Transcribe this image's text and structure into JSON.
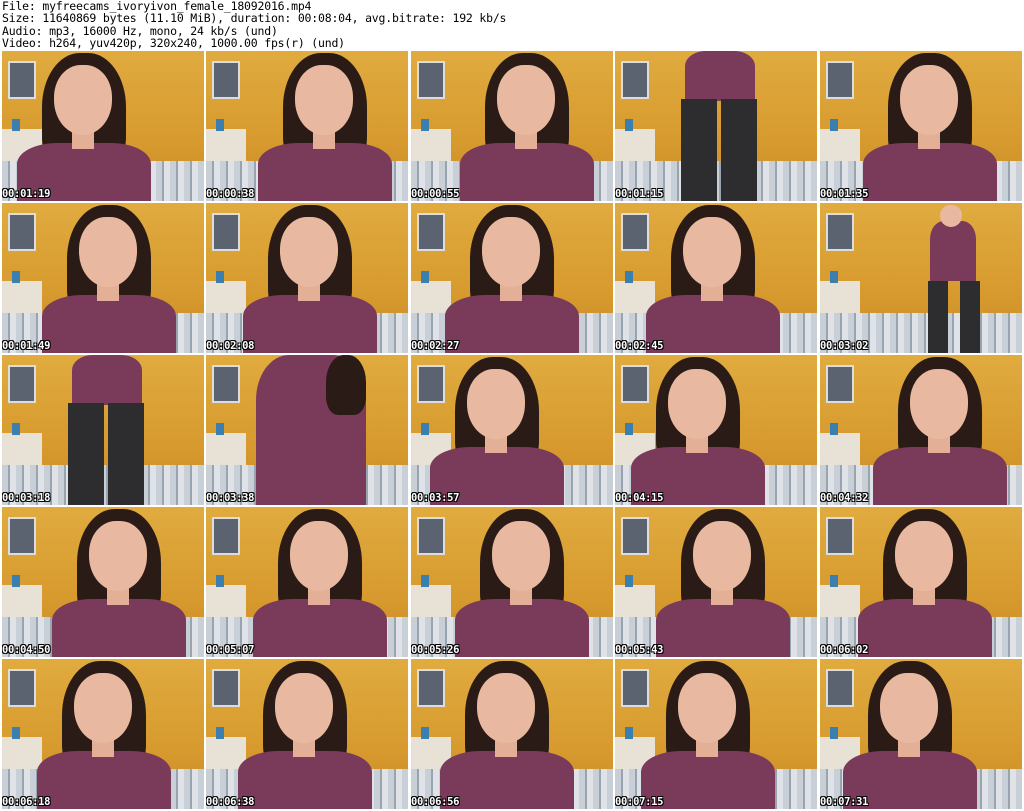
{
  "header": {
    "file_line": "File: myfreecams_ivoryivon_female_18092016.mp4",
    "size_line": "Size: 11640869 bytes (11.10 MiB), duration: 00:08:04, avg.bitrate: 192 kb/s",
    "audio_line": "Audio: mp3, 16000 Hz, mono, 24 kb/s (und)",
    "video_line": "Video: h264, yuv420p, 320x240, 1000.00 fps(r) (und)"
  },
  "thumbnails": [
    {
      "time": "00:01:19",
      "pose": "face"
    },
    {
      "time": "00:00:38",
      "pose": "face"
    },
    {
      "time": "00:00:55",
      "pose": "face"
    },
    {
      "time": "00:01:15",
      "pose": "standing-back"
    },
    {
      "time": "00:01:35",
      "pose": "face"
    },
    {
      "time": "00:01:49",
      "pose": "face"
    },
    {
      "time": "00:02:08",
      "pose": "face"
    },
    {
      "time": "00:02:27",
      "pose": "face"
    },
    {
      "time": "00:02:45",
      "pose": "face"
    },
    {
      "time": "00:03:02",
      "pose": "standing"
    },
    {
      "time": "00:03:18",
      "pose": "standing-back"
    },
    {
      "time": "00:03:38",
      "pose": "shirt"
    },
    {
      "time": "00:03:57",
      "pose": "face"
    },
    {
      "time": "00:04:15",
      "pose": "face"
    },
    {
      "time": "00:04:32",
      "pose": "face"
    },
    {
      "time": "00:04:50",
      "pose": "face"
    },
    {
      "time": "00:05:07",
      "pose": "face"
    },
    {
      "time": "00:05:26",
      "pose": "face"
    },
    {
      "time": "00:05:43",
      "pose": "face"
    },
    {
      "time": "00:06:02",
      "pose": "face"
    },
    {
      "time": "00:06:18",
      "pose": "face"
    },
    {
      "time": "00:06:38",
      "pose": "face"
    },
    {
      "time": "00:06:56",
      "pose": "face"
    },
    {
      "time": "00:07:15",
      "pose": "face"
    },
    {
      "time": "00:07:31",
      "pose": "face"
    }
  ]
}
